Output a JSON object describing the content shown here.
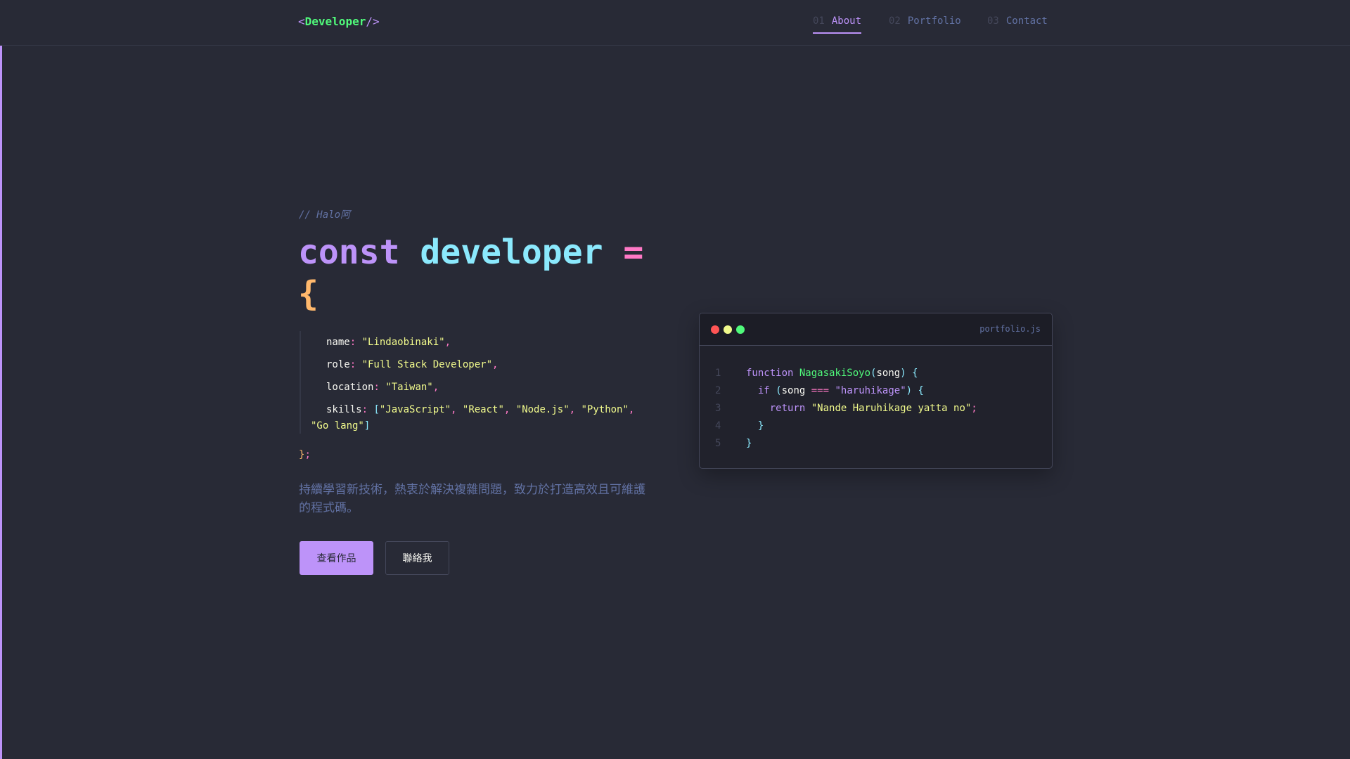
{
  "nav": {
    "logo": {
      "open": "<",
      "name": "Developer",
      "close": "/>"
    },
    "items": [
      {
        "num": "01",
        "label": "About",
        "active": true
      },
      {
        "num": "02",
        "label": "Portfolio"
      },
      {
        "num": "03",
        "label": "Contact"
      }
    ]
  },
  "hero": {
    "comment": "// Halo阿",
    "kw": "const",
    "id": "developer",
    "op": "=",
    "brace": "{",
    "fields": {
      "name_key": "name",
      "name_val": "\"Lindaobinaki\"",
      "role_key": "role",
      "role_val": "\"Full Stack Developer\"",
      "loc_key": "location",
      "loc_val": "\"Taiwan\"",
      "skills_key": "skills",
      "skills": [
        "\"JavaScript\"",
        "\"React\"",
        "\"Node.js\"",
        "\"Python\"",
        "\"Go lang\""
      ]
    },
    "close": "}",
    "semi": ";",
    "description": "持續學習新技術，熱衷於解決複雜問題，致力於打造高效且可維護的程式碼。",
    "btn_primary": "查看作品",
    "btn_secondary": "聯絡我"
  },
  "editor": {
    "filename": "portfolio.js",
    "colors": {
      "red": "#ff5555",
      "yellow": "#f1fa8c",
      "green": "#50fa7b"
    },
    "lines": [
      "1",
      "2",
      "3",
      "4",
      "5"
    ],
    "code": {
      "function": "function",
      "fname": "NagasakiSoyo",
      "param": "song",
      "if": "if",
      "eq": "===",
      "cmp": "\"haruhikage\"",
      "return": "return",
      "ret": "\"Nande Haruhikage yatta no\""
    }
  }
}
